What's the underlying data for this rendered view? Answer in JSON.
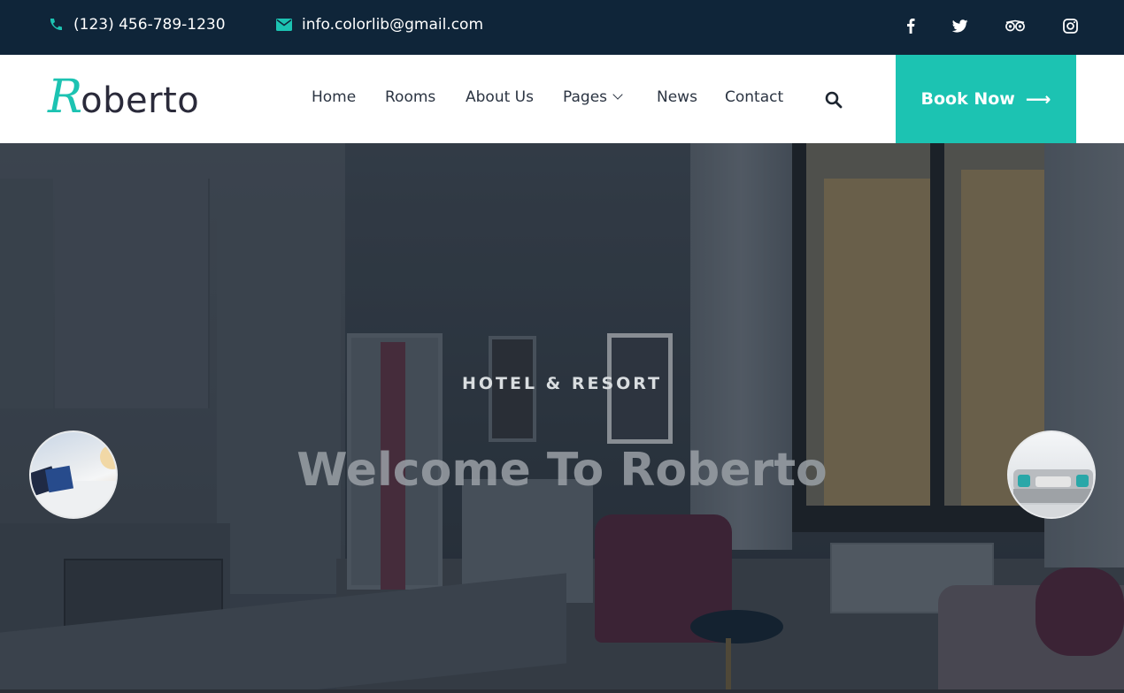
{
  "topbar": {
    "phone": "(123) 456-789-1230",
    "email": "info.colorlib@gmail.com",
    "social_icons": [
      "facebook-icon",
      "twitter-icon",
      "tripadvisor-icon",
      "instagram-icon"
    ]
  },
  "header": {
    "logo_initial": "R",
    "logo_rest": "oberto",
    "nav": {
      "home": "Home",
      "rooms": "Rooms",
      "about": "About Us",
      "pages": "Pages",
      "news": "News",
      "contact": "Contact"
    },
    "book_label": "Book Now",
    "book_arrow": "⟶"
  },
  "hero": {
    "subtitle": "HOTEL & RESORT",
    "title": "Welcome To Roberto"
  },
  "colors": {
    "accent": "#1cc3b2",
    "topbar_bg": "#0f2539",
    "header_bg": "#ffffff"
  }
}
